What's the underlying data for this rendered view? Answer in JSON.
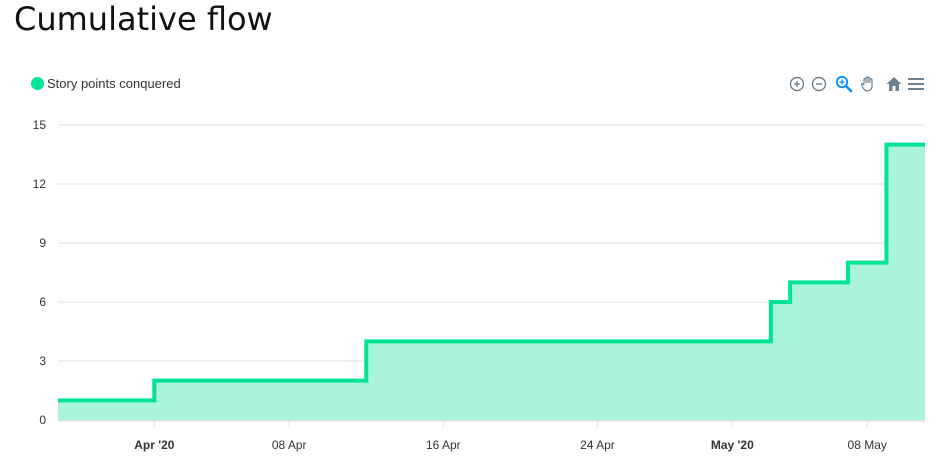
{
  "page": {
    "title": "Cumulative flow"
  },
  "toolbar": {
    "icons": [
      "zoom-in-icon",
      "zoom-out-icon",
      "selection-zoom-icon",
      "pan-icon",
      "home-icon",
      "menu-icon"
    ]
  },
  "colors": {
    "series": "#00e396",
    "fill": "#aaf4da",
    "grid": "#e0e0e0",
    "icon": "#6e8192",
    "icon_active": "#008ffb"
  },
  "chart_data": {
    "type": "area",
    "step": true,
    "xlim": [
      "2020-03-27",
      "2020-05-11"
    ],
    "ylim": [
      0,
      15
    ],
    "yticks": [
      "0",
      "3",
      "6",
      "9",
      "12",
      "15"
    ],
    "xticks": [
      {
        "date": "2020-04-01",
        "label": "Apr '20",
        "bold": true
      },
      {
        "date": "2020-04-08",
        "label": "08 Apr",
        "bold": false
      },
      {
        "date": "2020-04-16",
        "label": "16 Apr",
        "bold": false
      },
      {
        "date": "2020-04-24",
        "label": "24 Apr",
        "bold": false
      },
      {
        "date": "2020-05-01",
        "label": "May '20",
        "bold": true
      },
      {
        "date": "2020-05-08",
        "label": "08 May",
        "bold": false
      }
    ],
    "legend_position": "top-left",
    "grid": true,
    "series": [
      {
        "name": "Story points conquered",
        "points": [
          {
            "x": "2020-03-27",
            "y": 1
          },
          {
            "x": "2020-04-01",
            "y": 2
          },
          {
            "x": "2020-04-12",
            "y": 4
          },
          {
            "x": "2020-05-03",
            "y": 5
          },
          {
            "x": "2020-05-03",
            "y": 6
          },
          {
            "x": "2020-05-04",
            "y": 7
          },
          {
            "x": "2020-05-07",
            "y": 8
          },
          {
            "x": "2020-05-09",
            "y": 14
          }
        ]
      }
    ]
  }
}
